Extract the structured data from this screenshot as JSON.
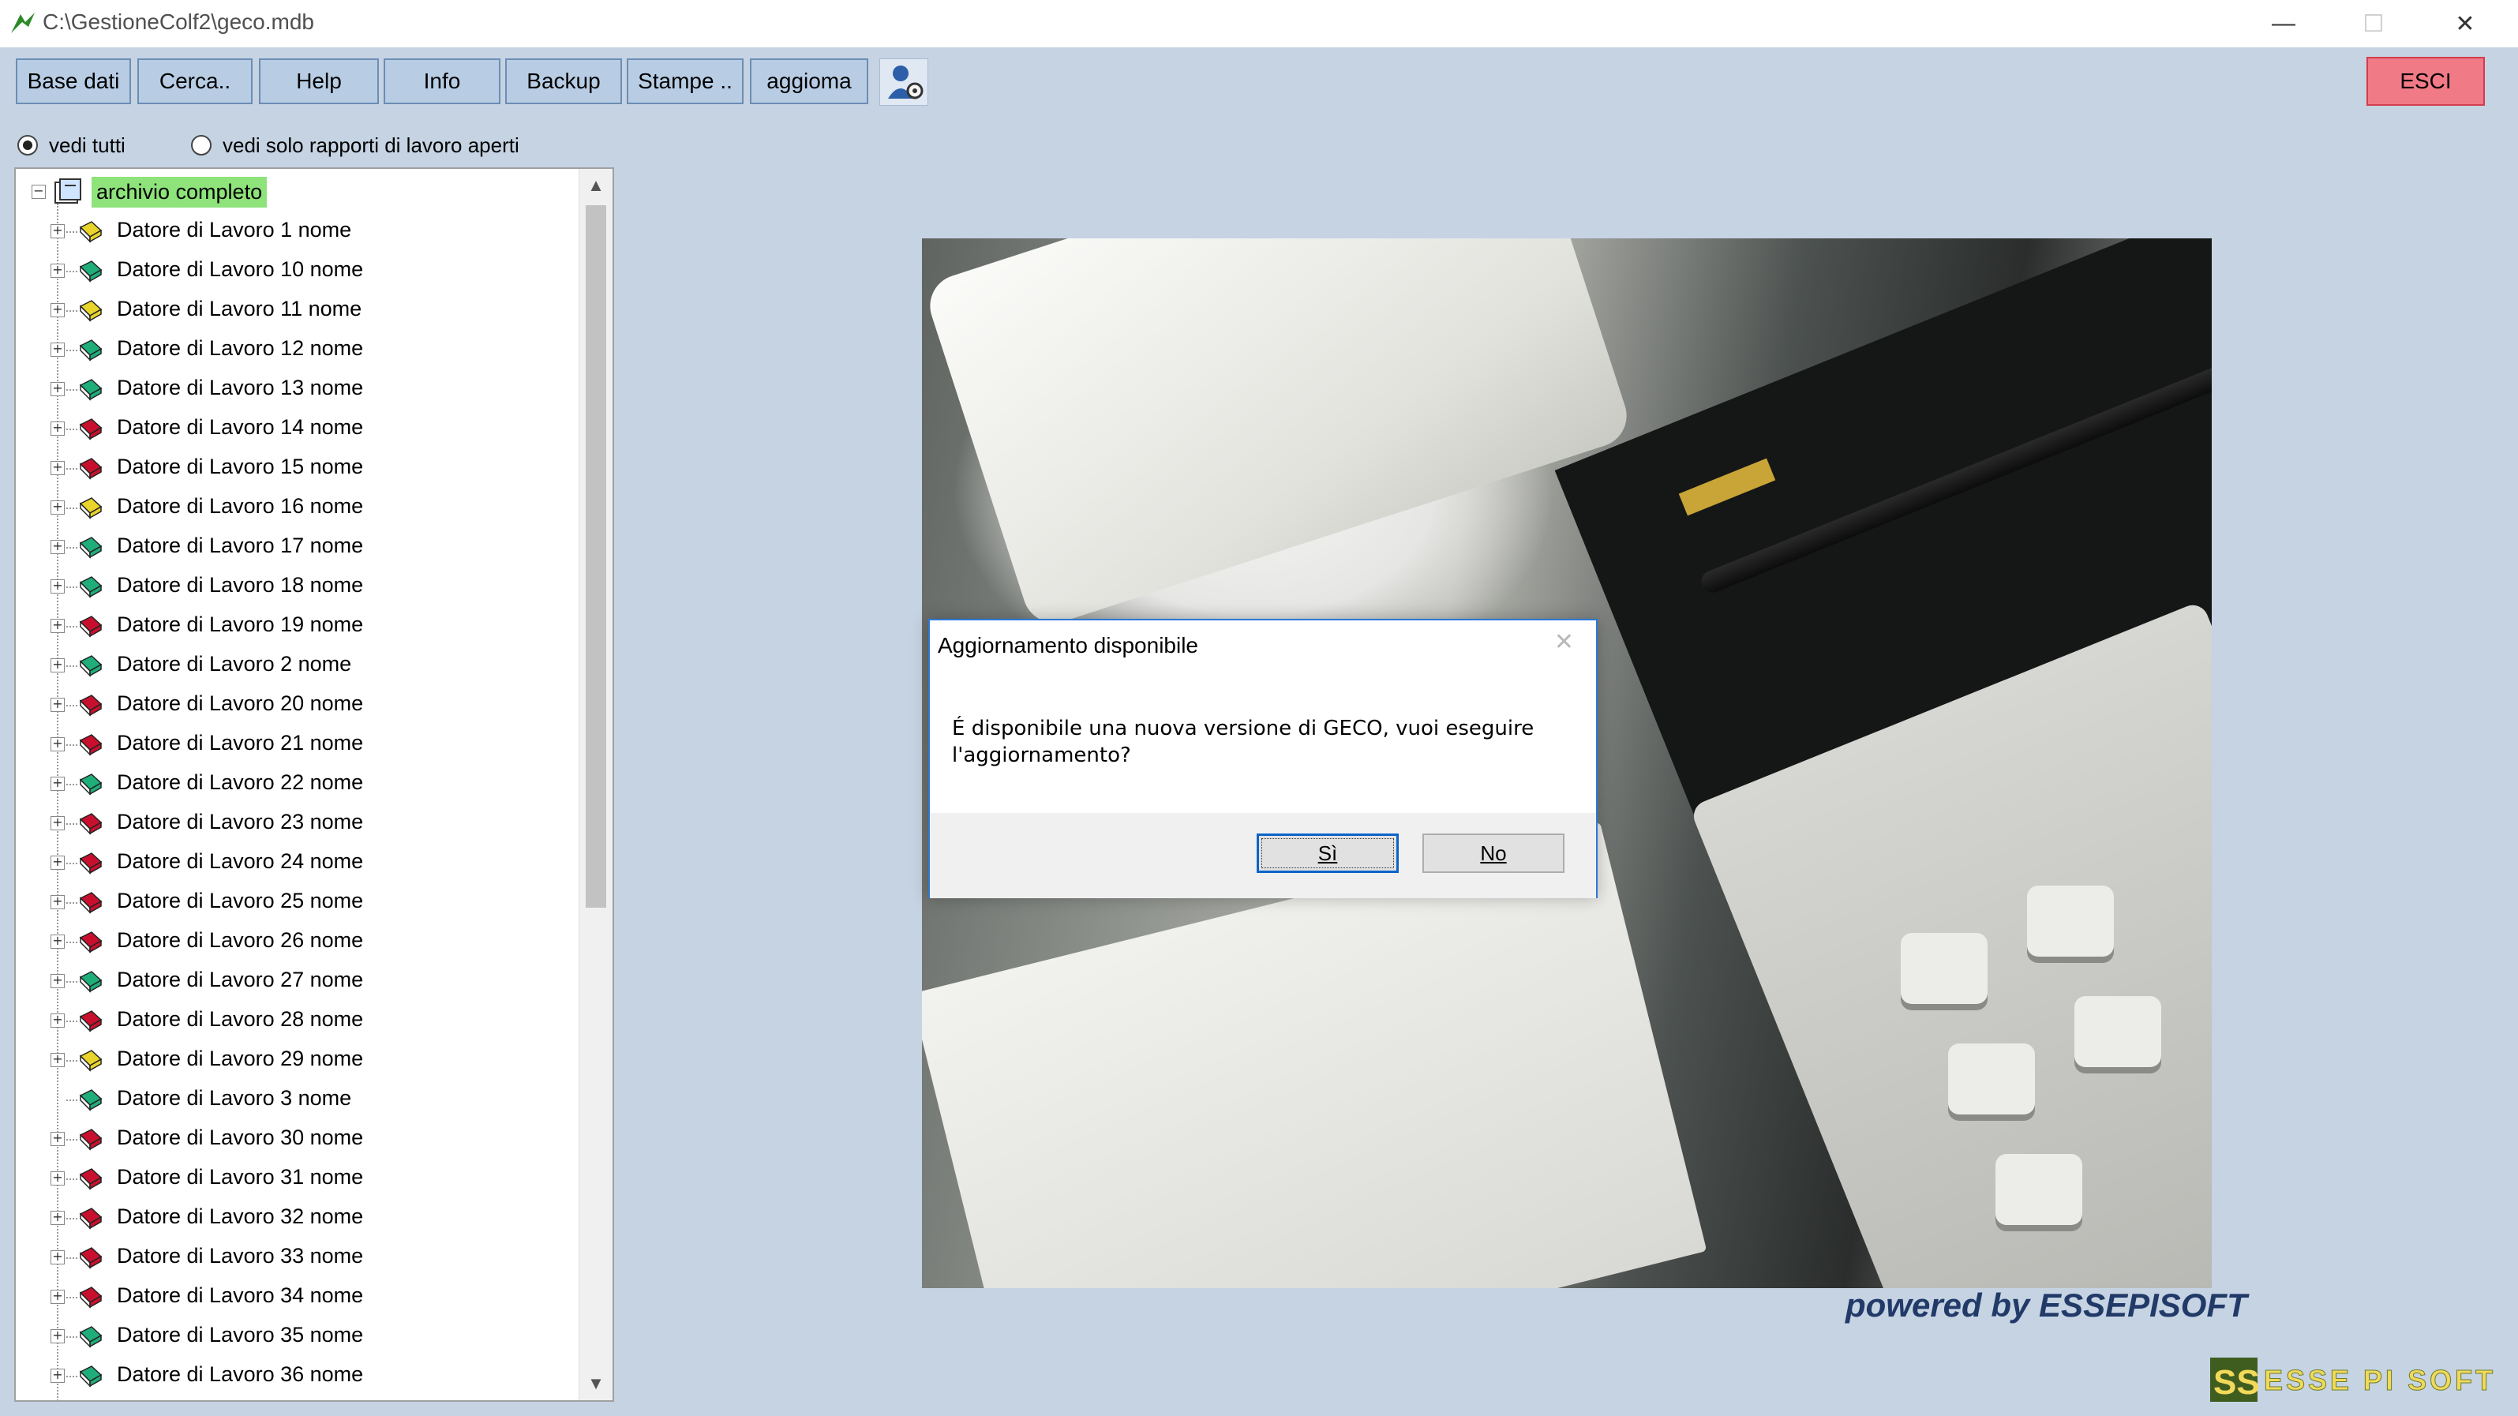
{
  "window": {
    "title": "C:\\GestioneColf2\\geco.mdb",
    "controls": {
      "minimize": "—",
      "maximize": "☐",
      "close": "✕"
    }
  },
  "toolbar": {
    "buttons": [
      "Base dati",
      "Cerca..",
      "Help",
      "Info",
      "Backup",
      "Stampe ..",
      "aggioma"
    ],
    "exit_label": "ESCI",
    "exit_color": "#f07a86"
  },
  "filter": {
    "options": [
      {
        "label": "vedi tutti",
        "checked": true
      },
      {
        "label": "vedi solo rapporti di lavoro aperti",
        "checked": false
      }
    ]
  },
  "tree": {
    "root_label": "archivio completo",
    "items": [
      {
        "label": "Datore di Lavoro 1 nome",
        "color": "yellow",
        "expandable": true
      },
      {
        "label": "Datore di Lavoro 10 nome",
        "color": "green",
        "expandable": true
      },
      {
        "label": "Datore di Lavoro 11 nome",
        "color": "yellow",
        "expandable": true
      },
      {
        "label": "Datore di Lavoro 12 nome",
        "color": "green",
        "expandable": true
      },
      {
        "label": "Datore di Lavoro 13 nome",
        "color": "green",
        "expandable": true
      },
      {
        "label": "Datore di Lavoro 14 nome",
        "color": "red",
        "expandable": true
      },
      {
        "label": "Datore di Lavoro 15 nome",
        "color": "red",
        "expandable": true
      },
      {
        "label": "Datore di Lavoro 16 nome",
        "color": "yellow",
        "expandable": true
      },
      {
        "label": "Datore di Lavoro 17 nome",
        "color": "green",
        "expandable": true
      },
      {
        "label": "Datore di Lavoro 18 nome",
        "color": "green",
        "expandable": true
      },
      {
        "label": "Datore di Lavoro 19 nome",
        "color": "red",
        "expandable": true
      },
      {
        "label": "Datore di Lavoro 2 nome",
        "color": "green",
        "expandable": true
      },
      {
        "label": "Datore di Lavoro 20 nome",
        "color": "red",
        "expandable": true
      },
      {
        "label": "Datore di Lavoro 21 nome",
        "color": "red",
        "expandable": true
      },
      {
        "label": "Datore di Lavoro 22 nome",
        "color": "green",
        "expandable": true
      },
      {
        "label": "Datore di Lavoro 23 nome",
        "color": "red",
        "expandable": true
      },
      {
        "label": "Datore di Lavoro 24 nome",
        "color": "red",
        "expandable": true
      },
      {
        "label": "Datore di Lavoro 25 nome",
        "color": "red",
        "expandable": true
      },
      {
        "label": "Datore di Lavoro 26 nome",
        "color": "red",
        "expandable": true
      },
      {
        "label": "Datore di Lavoro 27 nome",
        "color": "green",
        "expandable": true
      },
      {
        "label": "Datore di Lavoro 28 nome",
        "color": "red",
        "expandable": true
      },
      {
        "label": "Datore di Lavoro 29 nome",
        "color": "yellow",
        "expandable": true
      },
      {
        "label": "Datore di Lavoro 3 nome",
        "color": "green",
        "expandable": false
      },
      {
        "label": "Datore di Lavoro 30 nome",
        "color": "red",
        "expandable": true
      },
      {
        "label": "Datore di Lavoro 31 nome",
        "color": "red",
        "expandable": true
      },
      {
        "label": "Datore di Lavoro 32 nome",
        "color": "red",
        "expandable": true
      },
      {
        "label": "Datore di Lavoro 33 nome",
        "color": "red",
        "expandable": true
      },
      {
        "label": "Datore di Lavoro 34 nome",
        "color": "red",
        "expandable": true
      },
      {
        "label": "Datore di Lavoro 35 nome",
        "color": "green",
        "expandable": true
      },
      {
        "label": "Datore di Lavoro 36 nome",
        "color": "green",
        "expandable": true
      }
    ],
    "book_colors": {
      "yellow": "#e8d42a",
      "green": "#1fae7a",
      "red": "#c8102e"
    }
  },
  "dialog": {
    "title": "Aggiornamento disponibile",
    "close_icon": "✕",
    "message": "É disponibile una nuova versione di GECO, vuoi eseguire l'aggiornamento?",
    "yes_label": "Sì",
    "no_label": "No"
  },
  "footer": {
    "powered_by": "powered by ESSEPISOFT",
    "logo_text": "ESSE PI SOFT"
  }
}
